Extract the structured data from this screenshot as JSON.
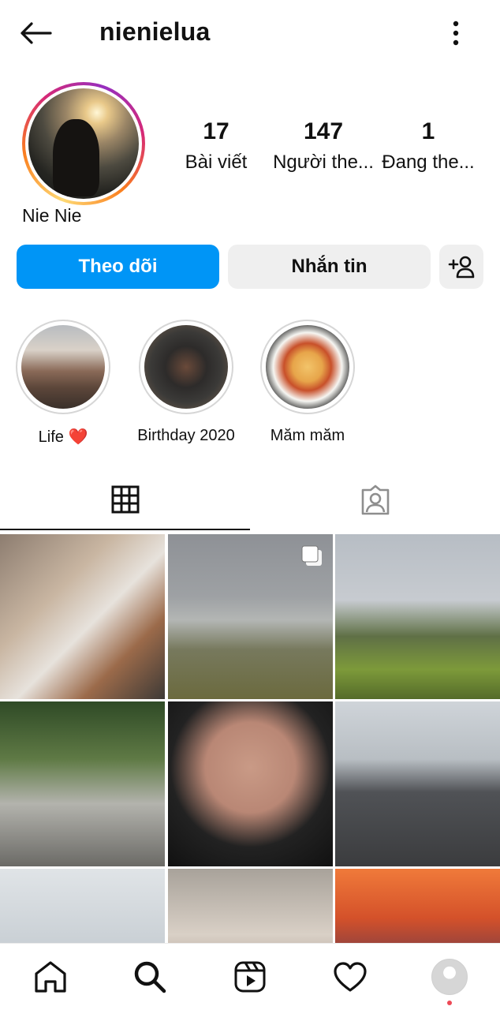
{
  "header": {
    "username": "nienielua",
    "back_icon": "arrow-left-icon",
    "more_icon": "vertical-dots-icon"
  },
  "profile": {
    "display_name": "Nie Nie",
    "stats": [
      {
        "value": "17",
        "label": "Bài viết"
      },
      {
        "value": "147",
        "label": "Người the..."
      },
      {
        "value": "1",
        "label": "Đang the..."
      }
    ]
  },
  "actions": {
    "follow_label": "Theo dõi",
    "message_label": "Nhắn tin",
    "add_user_icon": "add-person-icon"
  },
  "highlights": [
    {
      "label": "Life",
      "emoji": "❤️"
    },
    {
      "label": "Birthday 2020"
    },
    {
      "label": "Măm măm"
    }
  ],
  "tabs": {
    "grid_icon": "grid-icon",
    "tagged_icon": "tagged-person-icon"
  },
  "bottom_nav": [
    "home-icon",
    "search-icon",
    "reels-icon",
    "heart-icon",
    "profile-avatar"
  ],
  "colors": {
    "primary": "#0095f6",
    "secondary_button": "#efefef",
    "notification": "#ed4956"
  }
}
